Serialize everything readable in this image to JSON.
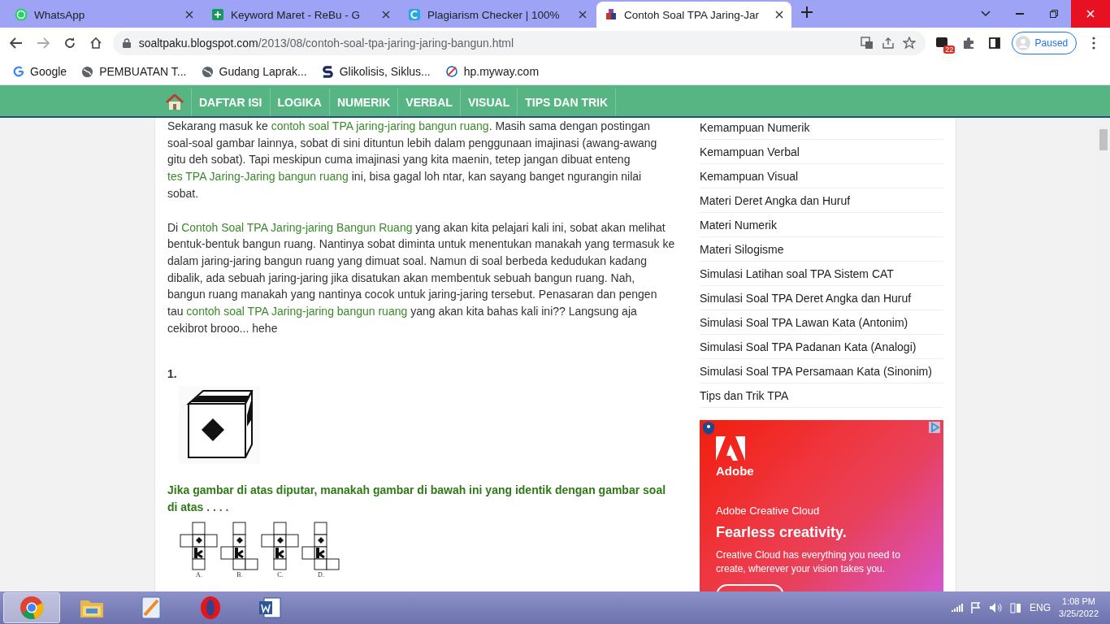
{
  "browser": {
    "tabs": [
      {
        "title": "WhatsApp",
        "selected": false
      },
      {
        "title": "Keyword Maret - ReBu - G",
        "selected": false
      },
      {
        "title": "Plagiarism Checker | 100%",
        "selected": false
      },
      {
        "title": "Contoh Soal TPA Jaring-Jar",
        "selected": true
      }
    ],
    "address": {
      "domain": "soaltpaku.blogspot.com",
      "path": "/2013/08/contoh-soal-tpa-jaring-jaring-bangun.html"
    },
    "extension_badge": "22",
    "profile": "Paused",
    "bookmarks": [
      "Google",
      "PEMBUATAN T...",
      "Gudang Laprak...",
      "Glikolisis, Siklus...",
      "hp.myway.com"
    ]
  },
  "nav": {
    "items": [
      "DAFTAR ISI",
      "LOGIKA",
      "NUMERIK",
      "VERBAL",
      "VISUAL",
      "TIPS DAN TRIK"
    ]
  },
  "article": {
    "paragraphs": [
      [
        {
          "text": "Sekarang masuk ke ",
          "link": false
        },
        {
          "text": "contoh soal TPA jaring-jaring bangun ruang",
          "link": true
        },
        {
          "text": ". Masih sama dengan postingan soal-soal gambar lainnya, sobat di sini dituntun lebih dalam penggunaan imajinasi (awang-awang gitu deh sobat). Tapi meskipun cuma imajinasi yang kita maenin, tetep jangan dibuat enteng ",
          "link": false
        },
        {
          "text": "tes TPA Jaring-Jaring bangun ruang",
          "link": true
        },
        {
          "text": " ini, bisa gagal loh ntar, kan sayang banget ngurangin nilai sobat.",
          "link": false
        }
      ],
      [
        {
          "text": "Di ",
          "link": false
        },
        {
          "text": "Contoh Soal TPA Jaring-jaring Bangun Ruang",
          "link": true
        },
        {
          "text": " yang akan kita pelajari kali ini, sobat akan melihat bentuk-bentuk bangun ruang. Nantinya sobat diminta untuk menentukan manakah yang termasuk ke dalam jaring-jaring bangun ruang yang dimuat soal. Namun di soal berbeda kedudukan kadang dibalik, ada sebuah jaring-jaring jika disatukan akan membentuk sebuah bangun ruang. Nah, bangun ruang manakah yang nantinya cocok untuk jaring-jaring tersebut. Penasaran dan pengen tau ",
          "link": false
        },
        {
          "text": "contoh soal TPA Jaring-jaring bangun ruang",
          "link": true
        },
        {
          "text": " yang akan kita bahas kali ini?? Langsung aja cekibrot brooo... hehe",
          "link": false
        }
      ]
    ],
    "question_number": "1.",
    "question": "Jika gambar di atas diputar, manakah gambar di bawah ini yang identik dengan gambar soal di atas . . . .",
    "net_labels": [
      "A.",
      "B.",
      "C.",
      "D."
    ]
  },
  "sidebar": {
    "items": [
      "Kemampuan Numerik",
      "Kemampuan Verbal",
      "Kemampuan Visual",
      "Materi Deret Angka dan Huruf",
      "Materi Numerik",
      "Materi Silogisme",
      "Simulasi Latihan soal TPA Sistem CAT",
      "Simulasi Soal TPA Deret Angka dan Huruf",
      "Simulasi Soal TPA Lawan Kata (Antonim)",
      "Simulasi Soal TPA Padanan Kata (Analogi)",
      "Simulasi Soal TPA Persamaan Kata (Sinonim)",
      "Tips dan Trik TPA"
    ]
  },
  "ad": {
    "brand": "Adobe",
    "product": "Adobe Creative Cloud",
    "headline": "Fearless creativity.",
    "body": "Creative Cloud has everything you need to create, wherever your vision takes you."
  },
  "taskbar": {
    "apps": [
      {
        "selected": true
      },
      {
        "selected": false
      },
      {
        "selected": false
      },
      {
        "selected": false
      },
      {
        "selected": false
      }
    ],
    "language": "ENG",
    "time": "1:08 PM",
    "date": "3/25/2022"
  }
}
